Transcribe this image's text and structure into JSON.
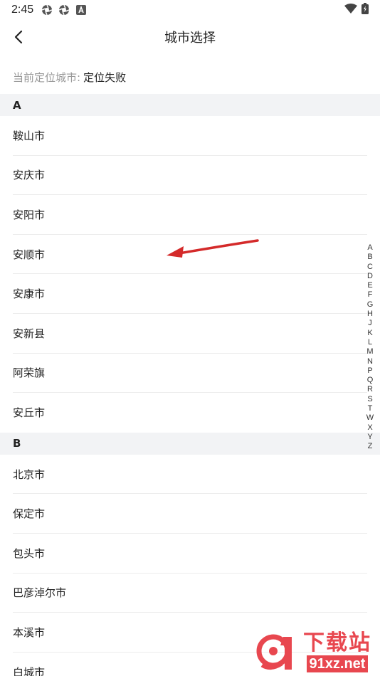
{
  "status_bar": {
    "time": "2:45",
    "left_icons": [
      "aperture-icon",
      "aperture-icon",
      "a-box-icon"
    ],
    "right_icons": [
      "wifi-icon",
      "battery-icon"
    ]
  },
  "nav": {
    "title": "城市选择",
    "back_icon": "chevron-left-icon"
  },
  "location": {
    "label": "当前定位城市:",
    "value": "定位失败"
  },
  "sections": [
    {
      "letter": "A",
      "cities": [
        "鞍山市",
        "安庆市",
        "安阳市",
        "安顺市",
        "安康市",
        "安新县",
        "阿荣旗",
        "安丘市"
      ]
    },
    {
      "letter": "B",
      "cities": [
        "北京市",
        "保定市",
        "包头市",
        "巴彦淖尔市",
        "本溪市",
        "白城市"
      ]
    }
  ],
  "index_letters": [
    "A",
    "B",
    "C",
    "D",
    "E",
    "F",
    "G",
    "H",
    "J",
    "K",
    "L",
    "M",
    "N",
    "P",
    "Q",
    "R",
    "S",
    "T",
    "W",
    "X",
    "Y",
    "Z"
  ],
  "watermark": {
    "title": "下载站",
    "url": "91xz.net",
    "color": "#e8474f"
  },
  "colors": {
    "section_bg": "#f2f3f5",
    "arrow": "#d42a2a",
    "label_gray": "#999999"
  }
}
